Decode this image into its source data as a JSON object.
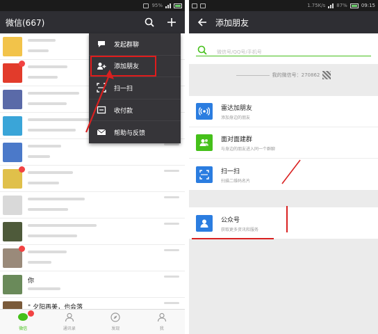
{
  "left": {
    "status": {
      "text": "95%",
      "time": ""
    },
    "appbar": {
      "title": "微信(667)"
    },
    "chats": [
      {
        "name": "",
        "msg": "",
        "time": "",
        "avatar_color": "#f2c34a",
        "badge": false
      },
      {
        "name": "",
        "msg": "",
        "time": "",
        "avatar_color": "#e23b2b",
        "badge": true
      },
      {
        "name": "",
        "msg": "",
        "time": "",
        "avatar_color": "#5a6aa8",
        "badge": false
      },
      {
        "name": "",
        "msg": "",
        "time": "",
        "avatar_color": "#3aa5d8",
        "badge": false
      },
      {
        "name": "",
        "msg": "",
        "time": "",
        "avatar_color": "#4b79c9",
        "badge": false
      },
      {
        "name": "",
        "msg": "",
        "time": "",
        "avatar_color": "#e0c04a",
        "badge": true
      },
      {
        "name": "",
        "msg": "",
        "time": "",
        "avatar_color": "#d9d9d9",
        "badge": false
      },
      {
        "name": "",
        "msg": "",
        "time": "",
        "avatar_color": "#4e5a3a",
        "badge": false
      },
      {
        "name": "",
        "msg": "",
        "time": "",
        "avatar_color": "#9a8a7a",
        "badge": true
      },
      {
        "name": "你",
        "msg": "",
        "time": "",
        "avatar_color": "#6a8a5a",
        "badge": false
      },
      {
        "name": "\" 夕阳再美，也会落",
        "msg": "",
        "time": "",
        "avatar_color": "#7a5a3a",
        "badge": false
      }
    ],
    "menu": [
      {
        "label": "发起群聊",
        "icon": "chat-bubble-icon"
      },
      {
        "label": "添加朋友",
        "icon": "add-contact-icon"
      },
      {
        "label": "扫一扫",
        "icon": "scan-icon"
      },
      {
        "label": "收付款",
        "icon": "payment-icon"
      },
      {
        "label": "帮助与反馈",
        "icon": "mail-icon"
      }
    ],
    "nav": [
      {
        "label": "微信",
        "icon": "chat-icon",
        "active": true
      },
      {
        "label": "通讯录",
        "icon": "contacts-icon",
        "active": false
      },
      {
        "label": "发现",
        "icon": "compass-icon",
        "active": false
      },
      {
        "label": "我",
        "icon": "person-icon",
        "active": false
      }
    ]
  },
  "right": {
    "status": {
      "text": "1.75K/s",
      "battery": "87%",
      "time": "09:15"
    },
    "appbar": {
      "title": "添加朋友"
    },
    "search": {
      "placeholder": "微信号/QQ号/手机号"
    },
    "my_id": "我的微信号：270862",
    "options": [
      {
        "title": "雷达加朋友",
        "desc": "添加身边的朋友",
        "icon": "radar-icon",
        "color": "#2b7de0"
      },
      {
        "title": "面对面建群",
        "desc": "与身边的朋友进入同一个群聊",
        "icon": "group-icon",
        "color": "#45c01a"
      },
      {
        "title": "扫一扫",
        "desc": "扫描二维码名片",
        "icon": "scan-icon",
        "color": "#2b7de0"
      }
    ],
    "options2": [
      {
        "title": "公众号",
        "desc": "获取更多资讯和服务",
        "icon": "official-account-icon",
        "color": "#2b7de0"
      }
    ]
  }
}
